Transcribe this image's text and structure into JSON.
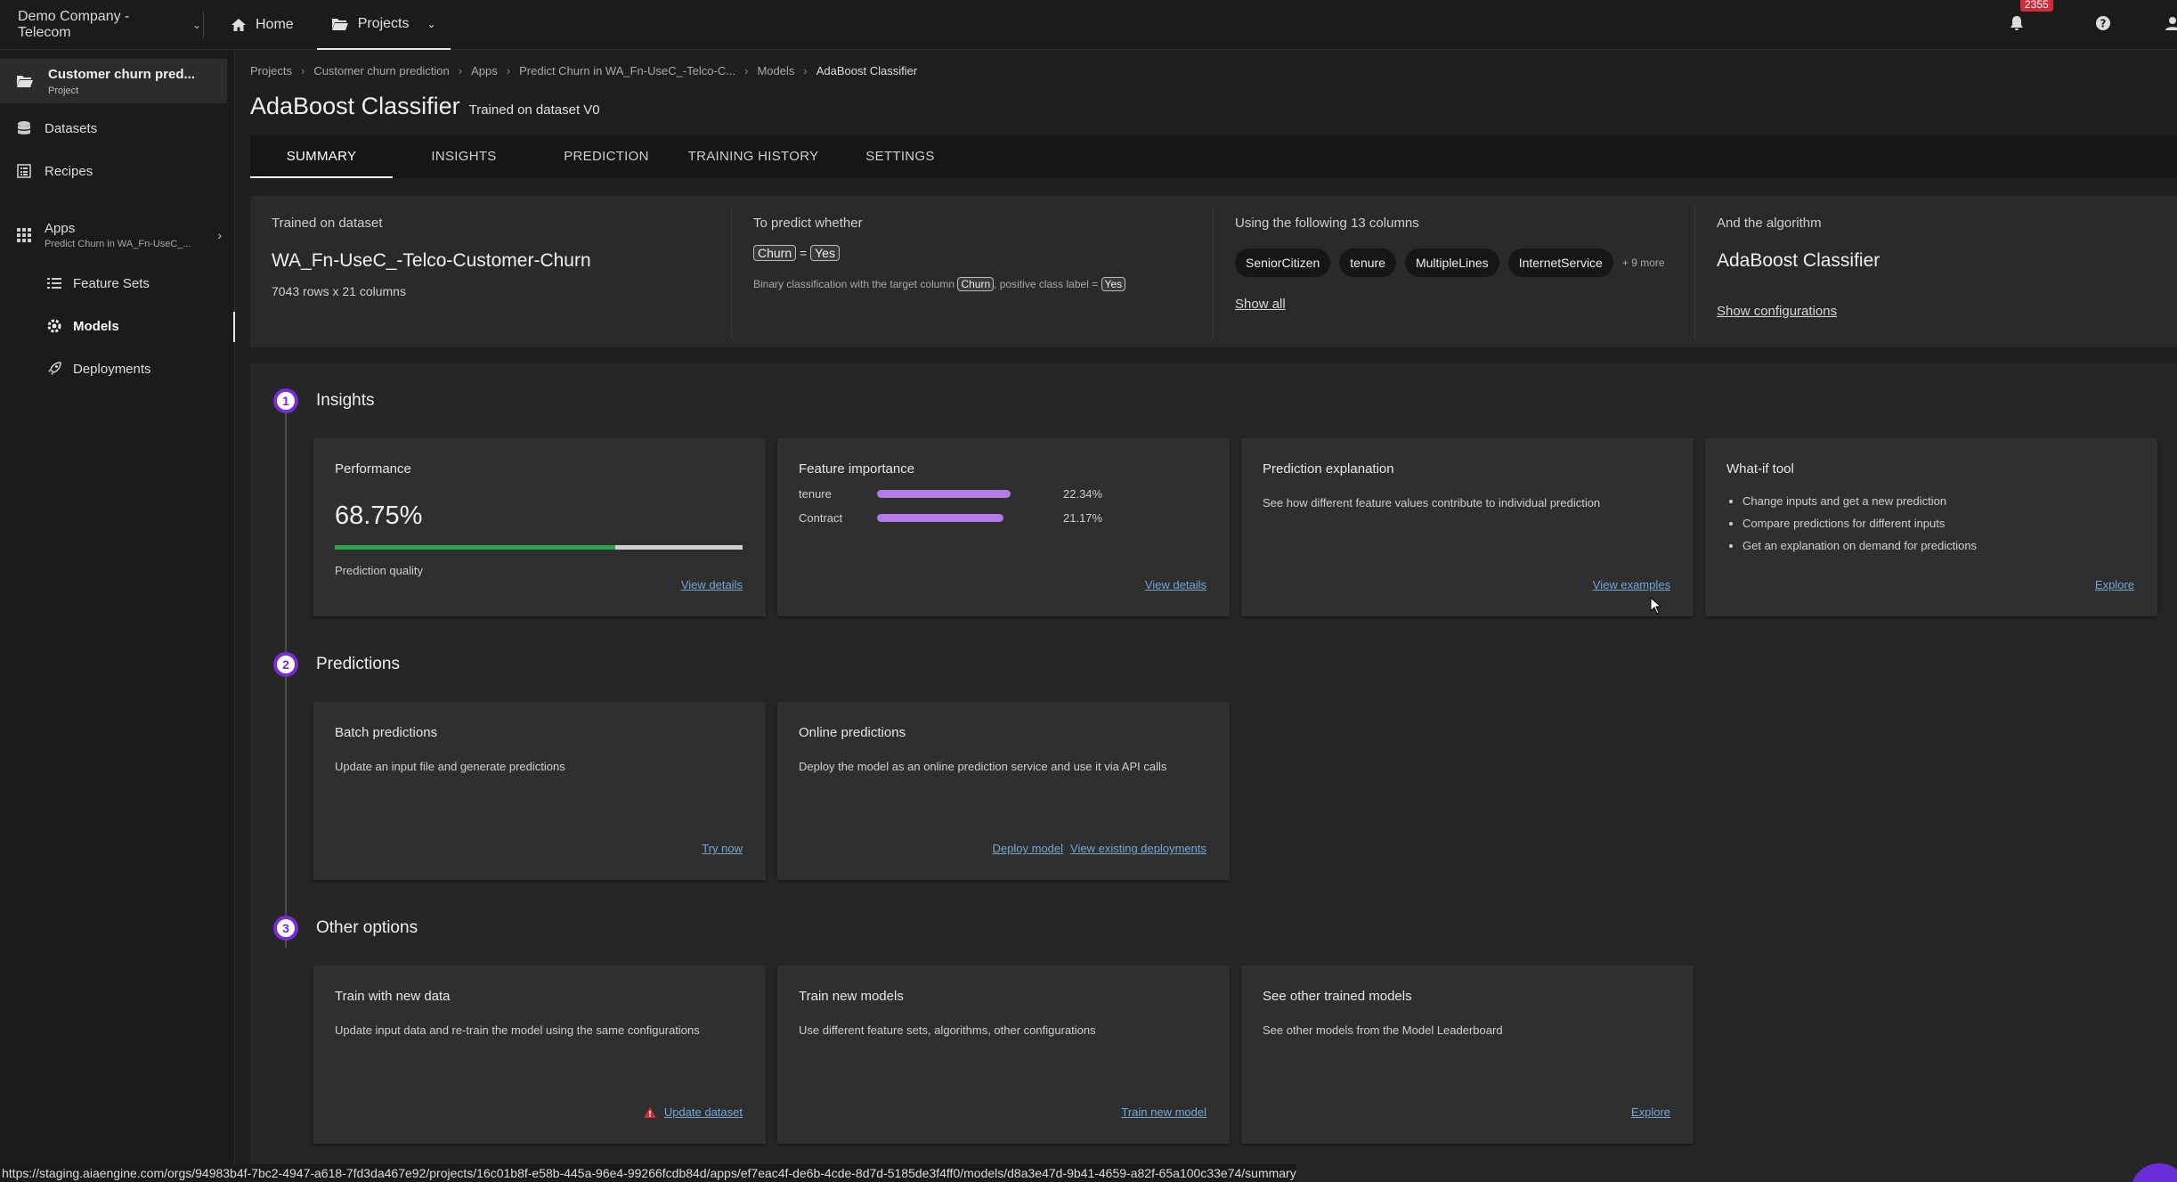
{
  "topbar": {
    "org": "Demo Company - Telecom",
    "home": "Home",
    "projects": "Projects",
    "notifications_count": "2355"
  },
  "sidebar": {
    "project_title": "Customer churn pred...",
    "project_sub": "Project",
    "items": [
      "Datasets",
      "Recipes"
    ],
    "apps_title": "Apps",
    "apps_sub": "Predict Churn in WA_Fn-UseC_...",
    "sub_items": [
      "Feature Sets",
      "Models",
      "Deployments"
    ]
  },
  "breadcrumbs": [
    "Projects",
    "Customer churn prediction",
    "Apps",
    "Predict Churn in WA_Fn-UseC_-Telco-C...",
    "Models",
    "AdaBoost Classifier"
  ],
  "page": {
    "title": "AdaBoost Classifier",
    "subtitle": "Trained on dataset V0"
  },
  "tabs": [
    "SUMMARY",
    "INSIGHTS",
    "PREDICTION",
    "TRAINING HISTORY",
    "SETTINGS"
  ],
  "summary": {
    "dataset_heading": "Trained on dataset",
    "dataset_name": "WA_Fn-UseC_-Telco-Customer-Churn",
    "dataset_size": "7043 rows x 21 columns",
    "predict_heading": "To predict whether",
    "target_col": "Churn",
    "eq": "=",
    "target_val": "Yes",
    "binary_text_1": "Binary classification with the target column",
    "binary_text_2": ", positive class label =",
    "columns_heading": "Using the following 13 columns",
    "columns": [
      "SeniorCitizen",
      "tenure",
      "MultipleLines",
      "InternetService"
    ],
    "columns_more": "+ 9 more",
    "show_all": "Show all",
    "algo_heading": "And the algorithm",
    "algo_name": "AdaBoost Classifier",
    "show_config": "Show configurations"
  },
  "sections": {
    "insights": {
      "num": "1",
      "label": "Insights",
      "performance": {
        "title": "Performance",
        "value": "68.75%",
        "fraction": 0.6875,
        "caption": "Prediction quality",
        "link": "View details"
      },
      "feature_importance": {
        "title": "Feature importance",
        "items": [
          {
            "name": "tenure",
            "value": "22.34%",
            "pct": 22.34
          },
          {
            "name": "Contract",
            "value": "21.17%",
            "pct": 21.17
          }
        ],
        "link": "View details"
      },
      "prediction_explanation": {
        "title": "Prediction explanation",
        "desc": "See how different feature values contribute to individual prediction",
        "link": "View examples"
      },
      "whatif": {
        "title": "What-if tool",
        "bullets": [
          "Change inputs and get a new prediction",
          "Compare predictions for different inputs",
          "Get an explanation on demand for predictions"
        ],
        "link": "Explore"
      }
    },
    "predictions": {
      "num": "2",
      "label": "Predictions",
      "batch": {
        "title": "Batch predictions",
        "desc": "Update an input file and generate predictions",
        "link": "Try now"
      },
      "online": {
        "title": "Online predictions",
        "desc": "Deploy the model as an online prediction service and use it via API calls",
        "link1": "Deploy model",
        "link2": "View existing deployments"
      }
    },
    "other": {
      "num": "3",
      "label": "Other options",
      "train_new_data": {
        "title": "Train with new data",
        "desc": "Update input data and re-train the model using the same configurations",
        "link": "Update dataset"
      },
      "train_new_models": {
        "title": "Train new models",
        "desc": "Use different feature sets, algorithms, other configurations",
        "link": "Train new model"
      },
      "other_models": {
        "title": "See other trained models",
        "desc": "See other models from the Model Leaderboard",
        "link": "Explore"
      }
    }
  },
  "statusbar": "https://staging.aiaengine.com/orgs/94983b4f-7bc2-4947-a618-7fd3da467e92/projects/16c01b8f-e58b-445a-96e4-99266fcdb84d/apps/ef7eac4f-de6b-4cde-8d7d-5185de3f4ff0/models/d8a3e47d-9b41-4659-a82f-65a100c33e74/summary",
  "colors": {
    "accent": "#7a2ad8",
    "bar": "#b57be8",
    "perf": "#27a745",
    "link": "#6fa9d8",
    "warning": "#d12a3b"
  }
}
